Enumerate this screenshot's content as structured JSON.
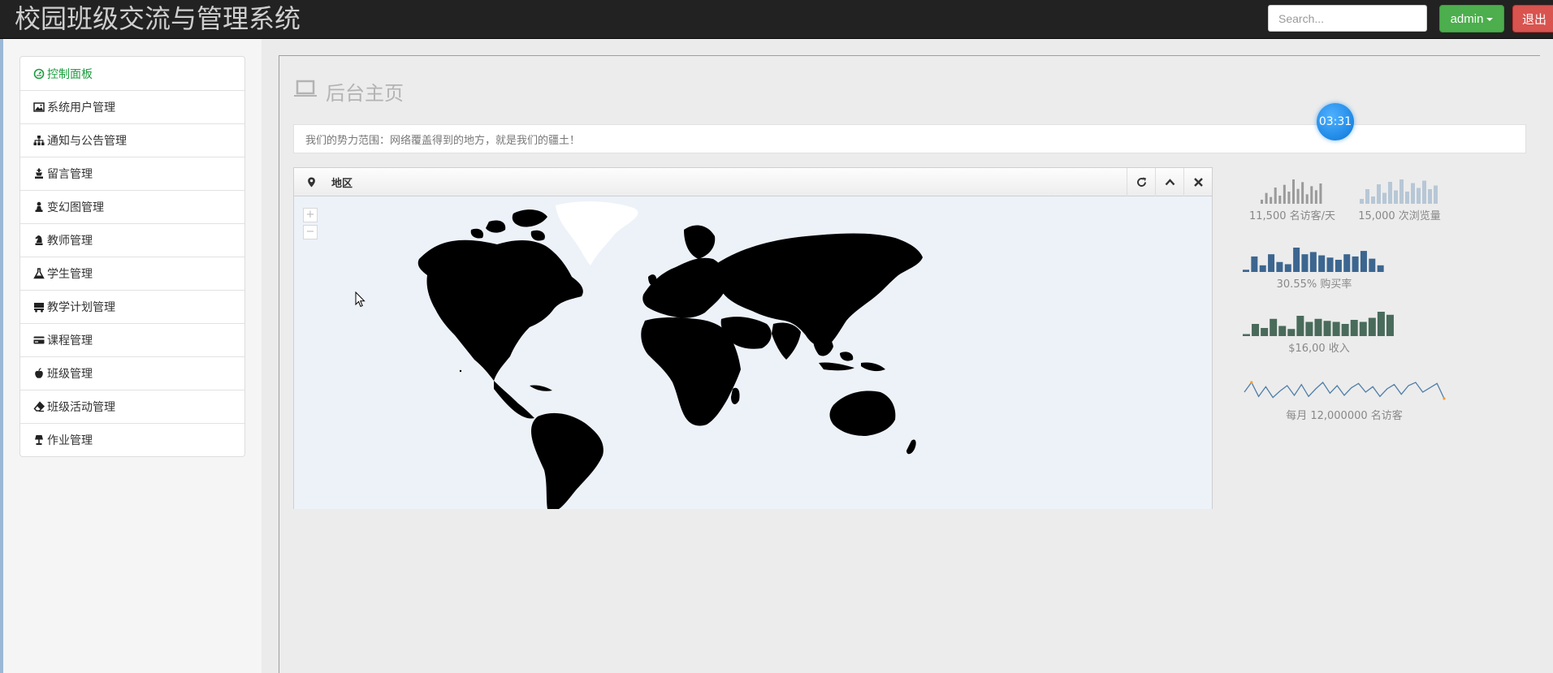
{
  "header": {
    "title": "校园班级交流与管理系统",
    "search_placeholder": "Search...",
    "user_label": "admin",
    "logout_label": "退出"
  },
  "sidebar": {
    "items": [
      {
        "label": "控制面板",
        "icon": "dashboard-icon",
        "active": true
      },
      {
        "label": "系统用户管理",
        "icon": "picture-icon"
      },
      {
        "label": "通知与公告管理",
        "icon": "sitemap-icon"
      },
      {
        "label": "留言管理",
        "icon": "king-icon"
      },
      {
        "label": "变幻图管理",
        "icon": "pawn-icon"
      },
      {
        "label": "教师管理",
        "icon": "knight-icon"
      },
      {
        "label": "学生管理",
        "icon": "flask-icon"
      },
      {
        "label": "教学计划管理",
        "icon": "truck-icon"
      },
      {
        "label": "课程管理",
        "icon": "credit-card-icon"
      },
      {
        "label": "班级管理",
        "icon": "apple-icon"
      },
      {
        "label": "班级活动管理",
        "icon": "eraser-icon"
      },
      {
        "label": "作业管理",
        "icon": "lamp-icon"
      }
    ]
  },
  "main": {
    "page_title": "后台主页",
    "notice": "我们的势力范围：网络覆盖得到的地方，就是我们的疆土！",
    "timer": "03:31",
    "map_widget": {
      "title": "地区",
      "zoom_in": "+",
      "zoom_out": "−"
    }
  },
  "stats": [
    {
      "label": "11,500 名访客/天",
      "color": "#9a9a9a",
      "type": "bar",
      "values": [
        3,
        8,
        5,
        12,
        6,
        14,
        9,
        18,
        11,
        16,
        7,
        13,
        10,
        15
      ]
    },
    {
      "label": "15,000 次浏览量",
      "color": "#b7c7d6",
      "type": "bar",
      "values": [
        4,
        12,
        6,
        16,
        9,
        18,
        11,
        20,
        10,
        17,
        13,
        19,
        12,
        15
      ]
    },
    {
      "label": "30.55% 购买率",
      "color": "#3c6690",
      "type": "bar",
      "values": [
        2,
        14,
        6,
        16,
        9,
        7,
        22,
        16,
        18,
        15,
        13,
        11,
        16,
        14,
        19,
        12,
        6
      ]
    },
    {
      "label": "$16,00 收入",
      "color": "#496b5b",
      "type": "bar",
      "values": [
        2,
        12,
        8,
        17,
        10,
        7,
        20,
        14,
        17,
        15,
        14,
        12,
        16,
        14,
        18,
        24,
        21
      ]
    },
    {
      "label": "每月 12,000000 名访客",
      "color": "#4f7ea8",
      "type": "line",
      "values": [
        9,
        18,
        5,
        14,
        4,
        10,
        15,
        6,
        16,
        5,
        12,
        18,
        8,
        15,
        6,
        13,
        17,
        9,
        14,
        5,
        12,
        16,
        7,
        15,
        18,
        9,
        13,
        17,
        3
      ]
    }
  ],
  "colors": {
    "brand_green": "#4cae4c",
    "danger_red": "#d9534f",
    "active_menu": "#1a9c3e"
  }
}
